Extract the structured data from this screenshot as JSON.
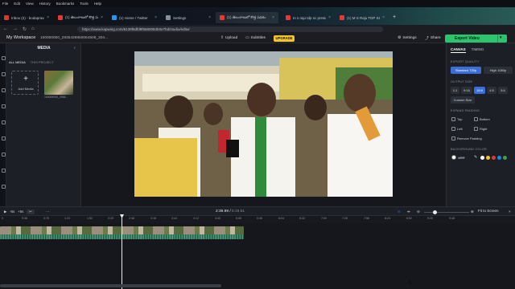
{
  "browser": {
    "menu": [
      "File",
      "Edit",
      "View",
      "History",
      "Bookmarks",
      "Tools",
      "Help"
    ],
    "tabs": [
      {
        "label": "Inbox (2) - bodapraved5671@gmail.com",
        "color": "#d33b2f"
      },
      {
        "label": "(1) తెలంగాణలో కొత్త పథకం",
        "color": "#e53935"
      },
      {
        "label": "(1) Home / Twitter",
        "color": "#1d9bf0"
      },
      {
        "label": "Settings",
        "color": "#8a8f97"
      },
      {
        "label": "(1) తెలంగాణలో కొత్త పథకం",
        "color": "#e53935"
      },
      {
        "label": "m s raju tdp sc president",
        "color": "#e53935"
      },
      {
        "label": "(1) M S Raju TDP SC Presi",
        "color": "#e53935"
      }
    ],
    "url": "https://www.kapwing.com/6139f6dfd9f6680084b0e7bd/studio/editor"
  },
  "header": {
    "workspace": "My Workspace",
    "project_name": "100000000_2935429850064508_304...",
    "upload": "Upload",
    "subtitles": "Subtitles",
    "upgrade": "UPGRADE",
    "settings": "Settings",
    "share": "Share",
    "export": "Export Video"
  },
  "media": {
    "title": "MEDIA",
    "tab_all": "ALL MEDIA",
    "tab_project": "THIS PROJECT",
    "add_media": "Add Media",
    "file_name": "100000000_2935..."
  },
  "right_panel": {
    "tab_canvas": "CANVAS",
    "tab_timing": "TIMING",
    "export_quality_label": "EXPORT QUALITY",
    "quality_standard": "Standard 720p",
    "quality_high": "High 1080p",
    "output_size_label": "OUTPUT SIZE",
    "sizes": [
      "1:1",
      "9:16",
      "16:9",
      "4:5",
      "5:4"
    ],
    "custom_size": "Custom Size",
    "expand_padding_label": "EXPAND PADDING",
    "pad_top": "Top",
    "pad_bottom": "Bottom",
    "pad_left": "Left",
    "pad_right": "Right",
    "remove_padding": "Remove Padding",
    "background_color_label": "BACKGROUND COLOR",
    "bg_value": "#ffffff",
    "swatches": [
      "#ffffff",
      "#f4c430",
      "#e53935",
      "#1e88e5",
      "#43a047"
    ]
  },
  "timeline": {
    "speed_minus": "-5s",
    "speed_plus": "+5s",
    "current_time": "2:39.99",
    "duration": "5:19.51",
    "fit": "Fit to Screen",
    "ticks": [
      "0",
      "0:38",
      "0:76",
      "1:24",
      "1:52",
      "2:20",
      "2:48",
      "3:16",
      "3:44",
      "4:12",
      "4:40",
      "5:08",
      "5:36",
      "6:04",
      "6:32",
      "7:00",
      "7:28",
      "7:56",
      "8:24",
      "8:52",
      "9:20",
      "9:48"
    ]
  },
  "colors": {
    "accent_blue": "#3b6fd6",
    "export_green": "#2cc46d",
    "upgrade_yellow": "#f4c430"
  }
}
